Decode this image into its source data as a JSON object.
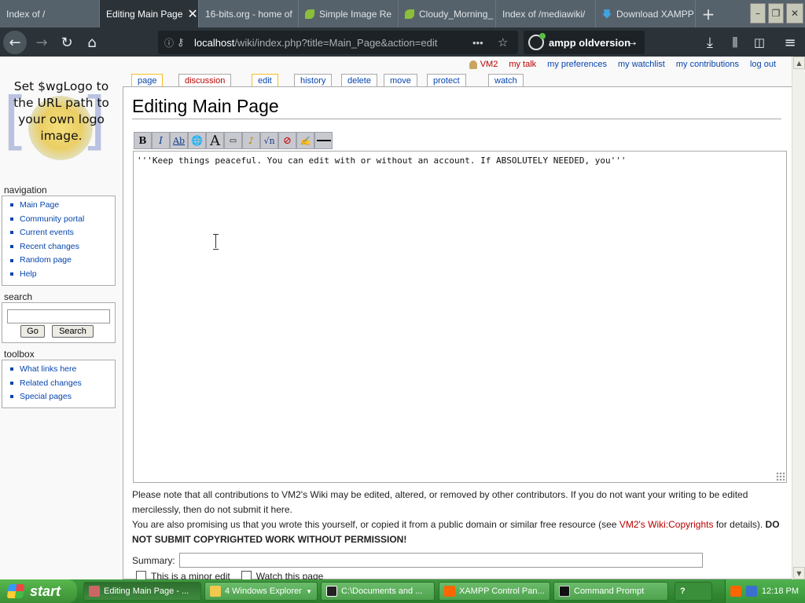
{
  "browser": {
    "tabs": [
      {
        "label": "Index of /",
        "favicon": "none"
      },
      {
        "label": "Editing Main Page",
        "favicon": "none",
        "active": true
      },
      {
        "label": "16-bits.org - home of",
        "favicon": "none"
      },
      {
        "label": "Simple Image Re",
        "favicon": "leaf-icon"
      },
      {
        "label": "Cloudy_Morning_",
        "favicon": "leaf-icon"
      },
      {
        "label": "Index of /mediawiki/",
        "favicon": "none"
      },
      {
        "label": "Download XAMPP",
        "favicon": "download-arrow-icon"
      }
    ],
    "new_tab": "+",
    "url_host": "localhost",
    "url_rest": "/wiki/index.php?title=Main_Page&action=edit",
    "search_text": "ampp oldversion"
  },
  "wiki": {
    "logo_text": "Set $wgLogo to the URL path to your own logo image.",
    "personal": {
      "user": "VM2",
      "talk": "my talk",
      "preferences": "my preferences",
      "watchlist": "my watchlist",
      "contributions": "my contributions",
      "logout": "log out"
    },
    "tabs": {
      "page": "page",
      "discussion": "discussion",
      "edit": "edit",
      "history": "history",
      "delete": "delete",
      "move": "move",
      "protect": "protect",
      "watch": "watch"
    },
    "title": "Editing Main Page",
    "editor_text": "'''Keep things peaceful. You can edit with or without an account. If ABSOLUTELY NEEDED, you'''",
    "navigation": {
      "title": "navigation",
      "items": [
        "Main Page",
        "Community portal",
        "Current events",
        "Recent changes",
        "Random page",
        "Help"
      ]
    },
    "search": {
      "title": "search",
      "go": "Go",
      "search": "Search"
    },
    "toolbox": {
      "title": "toolbox",
      "items": [
        "What links here",
        "Related changes",
        "Special pages"
      ]
    },
    "notice": {
      "line1": "Please note that all contributions to VM2's Wiki may be edited, altered, or removed by other contributors. If you do not want your writing to be edited mercilessly, then do not submit it here.",
      "line2_pre": "You are also promising us that you wrote this yourself, or copied it from a public domain or similar free resource (see ",
      "link": "VM2's Wiki:Copyrights",
      "line2_post": " for details). ",
      "warning": "DO NOT SUBMIT COPYRIGHTED WORK WITHOUT PERMISSION!"
    },
    "summary_label": "Summary:",
    "minor_edit": "This is a minor edit",
    "watch_page": "Watch this page"
  },
  "taskbar": {
    "start": "start",
    "tasks": [
      "Editing Main Page - ...",
      "4 Windows Explorer",
      "C:\\Documents and ...",
      "XAMPP Control Pan...",
      "Command Prompt"
    ],
    "clock": "12:18 PM"
  }
}
